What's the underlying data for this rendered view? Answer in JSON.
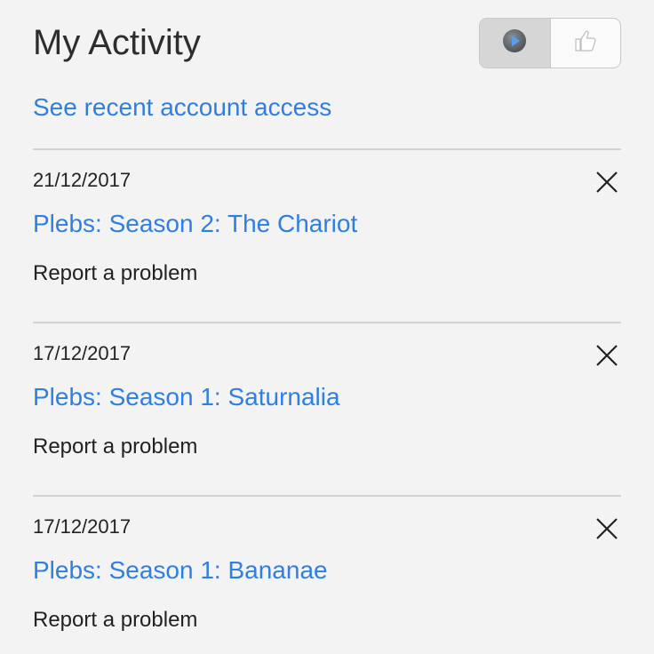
{
  "header": {
    "title": "My Activity",
    "toggle": {
      "options": [
        {
          "icon": "play-icon",
          "selected": true
        },
        {
          "icon": "thumbs-up-icon",
          "selected": false
        }
      ]
    }
  },
  "recent_access_link": "See recent account access",
  "activity": [
    {
      "date": "21/12/2017",
      "title": "Plebs: Season 2: The Chariot",
      "report_label": "Report a problem"
    },
    {
      "date": "17/12/2017",
      "title": "Plebs: Season 1: Saturnalia",
      "report_label": "Report a problem"
    },
    {
      "date": "17/12/2017",
      "title": "Plebs: Season 1: Bananae",
      "report_label": "Report a problem"
    }
  ],
  "colors": {
    "background": "#f3f3f3",
    "link": "#2f7fe0",
    "text": "#222222",
    "divider": "#d2d2d2"
  }
}
